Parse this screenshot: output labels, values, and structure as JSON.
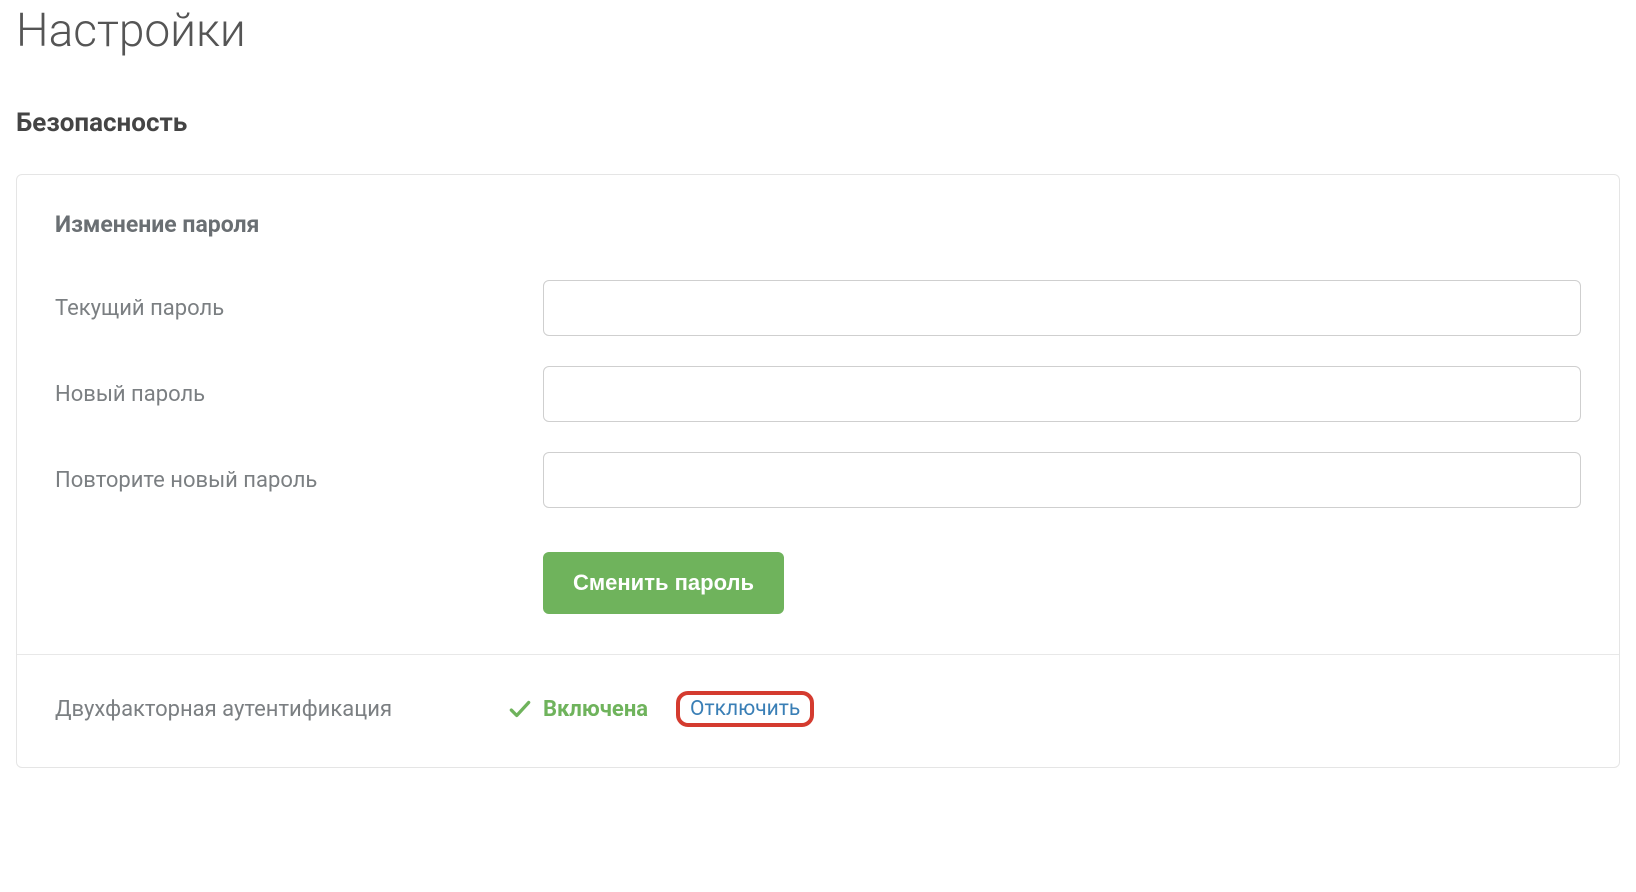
{
  "page": {
    "title": "Настройки"
  },
  "security": {
    "section_title": "Безопасность",
    "password": {
      "subtitle": "Изменение пароля",
      "current_label": "Текущий пароль",
      "new_label": "Новый пароль",
      "repeat_label": "Повторите новый пароль",
      "submit_label": "Сменить пароль"
    },
    "twofa": {
      "label": "Двухфакторная аутентификация",
      "status": "Включена",
      "disable_label": "Отключить"
    }
  }
}
